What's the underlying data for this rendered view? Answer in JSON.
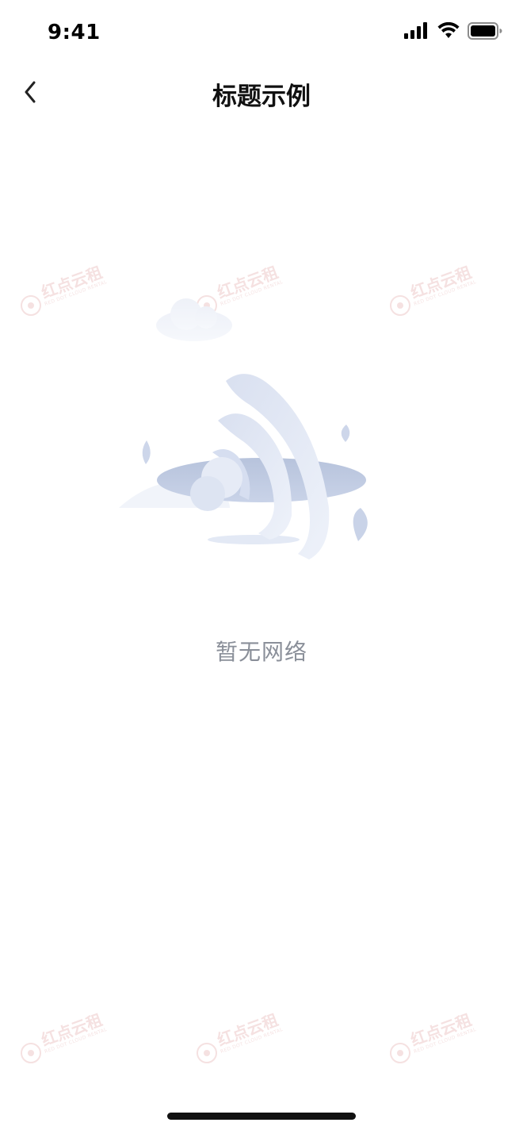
{
  "status_bar": {
    "time": "9:41"
  },
  "nav": {
    "title": "标题示例"
  },
  "empty_state": {
    "message": "暂无网络"
  },
  "watermark": {
    "brand": "红点云租",
    "tagline": "RED DOT CLOUD RENTAL"
  },
  "colors": {
    "illustration_primary": "#c9d3e8",
    "illustration_dark": "#aebbd6",
    "text_secondary": "#8a8f99"
  }
}
